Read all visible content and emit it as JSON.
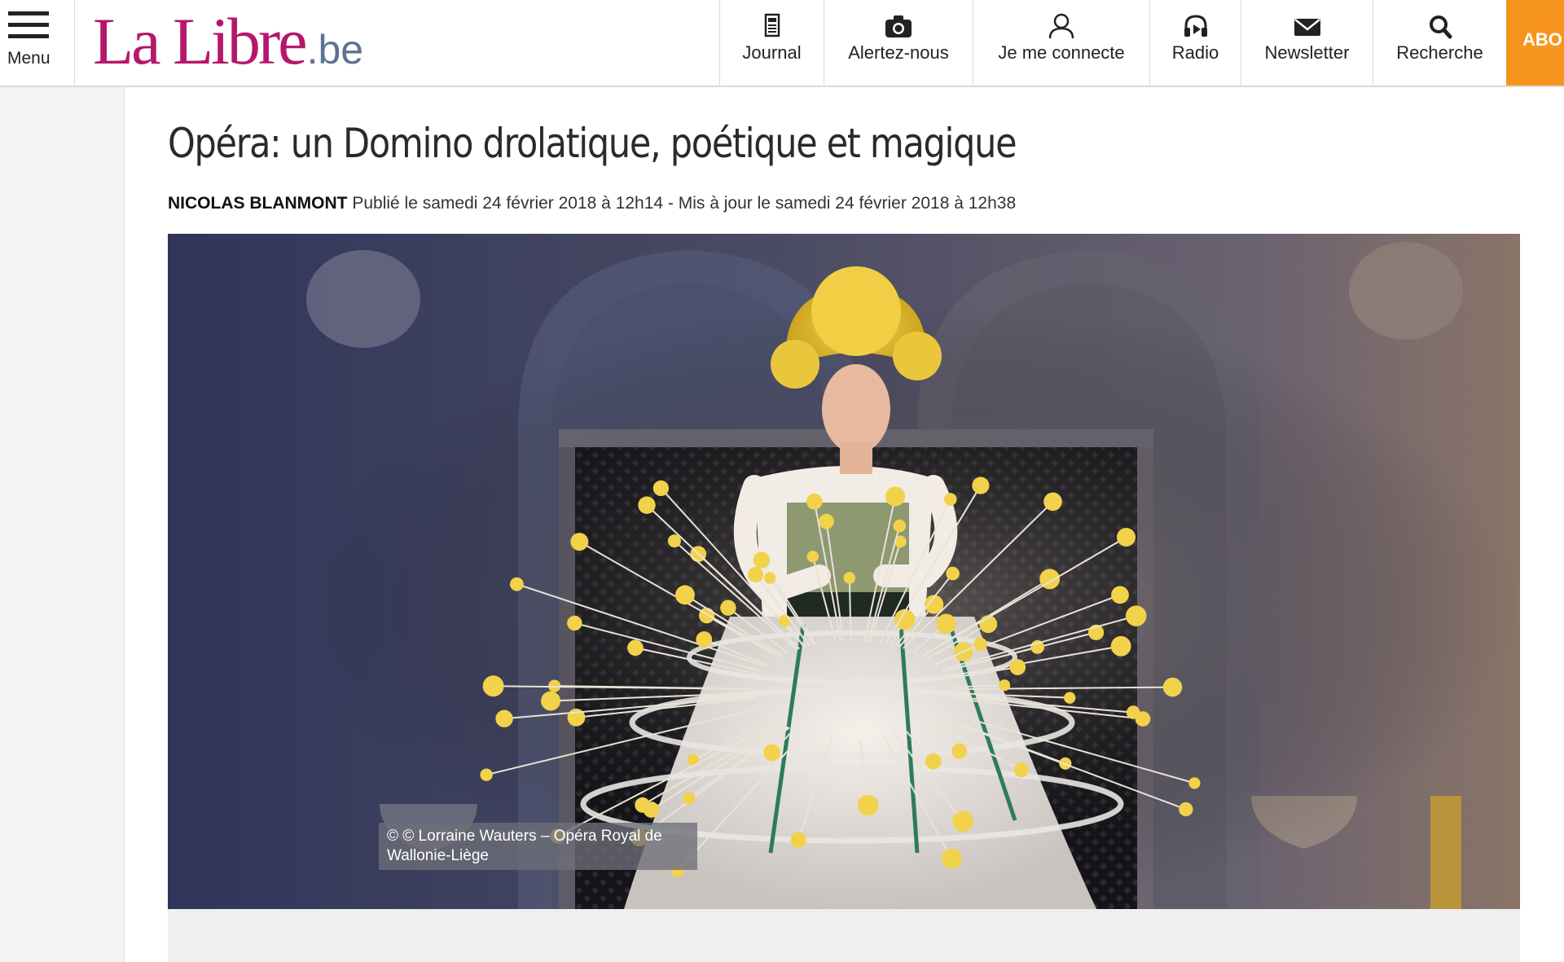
{
  "header": {
    "menu_label": "Menu",
    "logo_main": "La Libre",
    "logo_sub": ".be",
    "logo_color": "#b5176b",
    "nav": [
      {
        "label": "Journal",
        "icon": "newspaper-icon"
      },
      {
        "label": "Alertez-nous",
        "icon": "camera-icon"
      },
      {
        "label": "Je me connecte",
        "icon": "user-icon"
      },
      {
        "label": "Radio",
        "icon": "headphones-icon"
      },
      {
        "label": "Newsletter",
        "icon": "envelope-icon"
      },
      {
        "label": "Recherche",
        "icon": "search-icon"
      }
    ],
    "abo_label": "ABO",
    "abo_color": "#f7941d"
  },
  "article": {
    "title": "Opéra: un Domino drolatique, poétique et magique",
    "author": "NICOLAS BLANMONT",
    "published": "Publié le samedi 24 février 2018 à 12h14 - Mis à jour le samedi 24 février 2018 à 12h38",
    "photo_caption": "© © Lorraine Wauters – Opéra Royal de Wallonie-Liège"
  }
}
